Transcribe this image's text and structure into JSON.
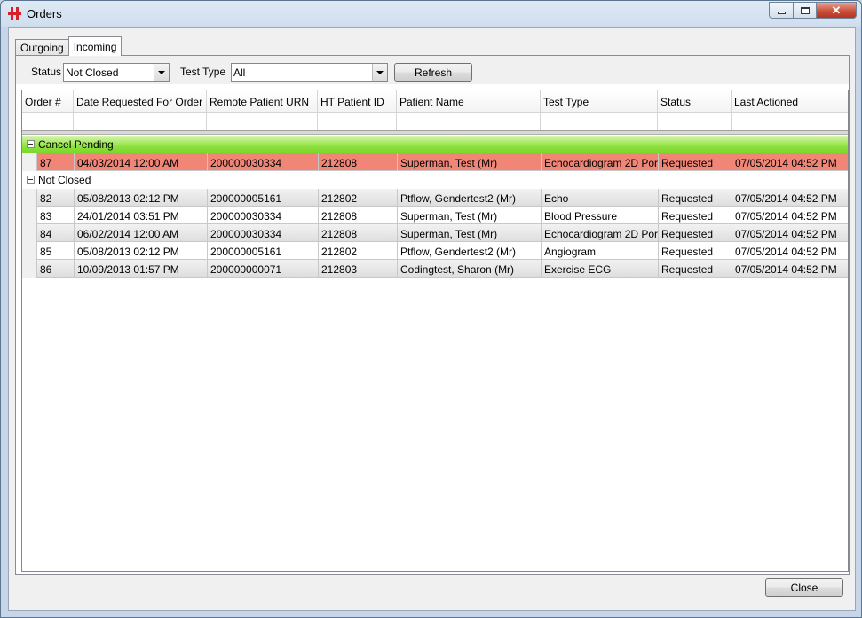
{
  "window": {
    "title": "Orders"
  },
  "tabs": [
    {
      "label": "Outgoing"
    },
    {
      "label": "Incoming"
    }
  ],
  "filters": {
    "status_label": "Status",
    "status_value": "Not Closed",
    "test_type_label": "Test Type",
    "test_type_value": "All",
    "refresh_label": "Refresh"
  },
  "grid": {
    "columns": [
      "Order #",
      "Date Requested For Order",
      "Remote Patient URN",
      "HT Patient ID",
      "Patient Name",
      "Test Type",
      "Status",
      "Last Actioned"
    ],
    "groups": [
      {
        "name": "Cancel Pending",
        "rows": [
          [
            "87",
            "04/03/2014  12:00 AM",
            "200000030334",
            "212808",
            "Superman, Test (Mr)",
            "Echocardiogram 2D Por…",
            "Requested",
            "07/05/2014  04:52 PM"
          ]
        ]
      },
      {
        "name": "Not Closed",
        "rows": [
          [
            "82",
            "05/08/2013  02:12 PM",
            "200000005161",
            "212802",
            "Ptflow, Gendertest2 (Mr)",
            "Echo",
            "Requested",
            "07/05/2014  04:52 PM"
          ],
          [
            "83",
            "24/01/2014  03:51 PM",
            "200000030334",
            "212808",
            "Superman, Test (Mr)",
            "Blood Pressure",
            "Requested",
            "07/05/2014  04:52 PM"
          ],
          [
            "84",
            "06/02/2014  12:00 AM",
            "200000030334",
            "212808",
            "Superman, Test (Mr)",
            "Echocardiogram 2D Por…",
            "Requested",
            "07/05/2014  04:52 PM"
          ],
          [
            "85",
            "05/08/2013  02:12 PM",
            "200000005161",
            "212802",
            "Ptflow, Gendertest2 (Mr)",
            "Angiogram",
            "Requested",
            "07/05/2014  04:52 PM"
          ],
          [
            "86",
            "10/09/2013  01:57 PM",
            "200000000071",
            "212803",
            "Codingtest, Sharon (Mr)",
            "Exercise ECG",
            "Requested",
            "07/05/2014  04:52 PM"
          ]
        ]
      }
    ]
  },
  "footer": {
    "close_label": "Close"
  },
  "colors": {
    "cancel_group": "#8ee23e",
    "highlight_row": "#f18576"
  }
}
